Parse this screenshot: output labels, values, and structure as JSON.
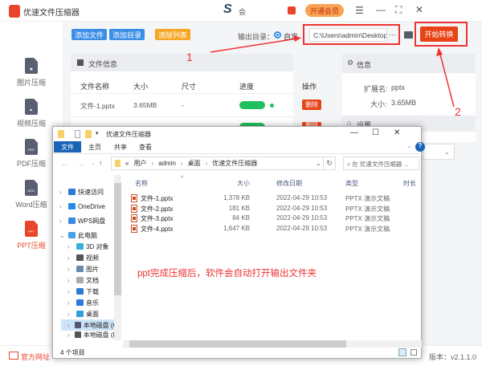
{
  "app": {
    "title": "优速文件压缩器",
    "user_text": "会",
    "vip_label": "开通会员"
  },
  "toolbar": {
    "add_file": "添加文件",
    "add_dir": "添加目录",
    "clear_list": "清除列表",
    "output_label": "输出目录：",
    "radio_custom": "自定义",
    "output_path": "C:\\Users\\admin\\Desktop",
    "more": "···",
    "start": "开始转换"
  },
  "sidebar": {
    "items": [
      {
        "label": "图片压缩",
        "icon": "image-file-icon",
        "glyph": "▣"
      },
      {
        "label": "视频压缩",
        "icon": "video-file-icon",
        "glyph": "▶"
      },
      {
        "label": "PDF压缩",
        "icon": "pdf-file-icon",
        "glyph": "PDF"
      },
      {
        "label": "Word压缩",
        "icon": "doc-file-icon",
        "glyph": "DOC"
      },
      {
        "label": "PPT压缩",
        "icon": "ppt-file-icon",
        "glyph": "PPT",
        "active": true
      }
    ]
  },
  "file_panel": {
    "title": "文件信息",
    "headers": [
      "文件名称",
      "大小",
      "尺寸",
      "进度",
      "操作"
    ],
    "rows": [
      {
        "name": "文件-1.pptx",
        "size": "3.65MB",
        "dim": "-",
        "progress": 100,
        "action": "删除"
      }
    ],
    "second_row_action": "删除"
  },
  "info_panel": {
    "title": "信息",
    "ext_label": "扩展名:",
    "ext": "pptx",
    "size_label": "大小:",
    "size": "3.65MB",
    "settings_title": "设置"
  },
  "annotations": {
    "n1": "1",
    "n2": "2",
    "note": "ppt完成压缩后，软件会自动打开输出文件夹",
    "color": "#ee3333"
  },
  "explorer": {
    "title": "优速文件压缩器",
    "tabs": [
      "文件",
      "主页",
      "共享",
      "查看"
    ],
    "breadcrumb": [
      "«",
      "用户",
      "admin",
      "桌面",
      "优速文件压缩器"
    ],
    "search_placeholder": "在 优速文件压缩器 ...",
    "nav": [
      {
        "label": "快速访问",
        "color": "#2a7ad6"
      },
      {
        "label": "OneDrive",
        "color": "#2a8ae6"
      },
      {
        "label": "WPS网盘",
        "color": "#3a8ae0"
      },
      {
        "label": "此电脑",
        "color": "#4aa0e8"
      },
      {
        "label": "3D 对象",
        "color": "#3ab0d8"
      },
      {
        "label": "视频",
        "color": "#555"
      },
      {
        "label": "图片",
        "color": "#6a8ab0"
      },
      {
        "label": "文档",
        "color": "#aab"
      },
      {
        "label": "下载",
        "color": "#2a7ad6"
      },
      {
        "label": "音乐",
        "color": "#2a7ad6"
      },
      {
        "label": "桌面",
        "color": "#3a9ae0"
      },
      {
        "label": "本地磁盘 (C:)",
        "color": "#557"
      },
      {
        "label": "本地磁盘 (D:)",
        "color": "#555"
      }
    ],
    "columns": [
      "名称",
      "大小",
      "修改日期",
      "类型",
      "时长"
    ],
    "files": [
      {
        "name": "文件-1.pptx",
        "size": "1,378 KB",
        "date": "2022-04-29 10:53",
        "type": "PPTX 演示文稿"
      },
      {
        "name": "文件-2.pptx",
        "size": "181 KB",
        "date": "2022-04-29 10:53",
        "type": "PPTX 演示文稿"
      },
      {
        "name": "文件-3.pptx",
        "size": "84 KB",
        "date": "2022-04-29 10:53",
        "type": "PPTX 演示文稿"
      },
      {
        "name": "文件-4.pptx",
        "size": "1,647 KB",
        "date": "2022-04-29 10:53",
        "type": "PPTX 演示文稿"
      }
    ],
    "status": "4 个项目"
  },
  "footer": {
    "website": "官方网址",
    "version": "版本：v2.1.1.0"
  }
}
